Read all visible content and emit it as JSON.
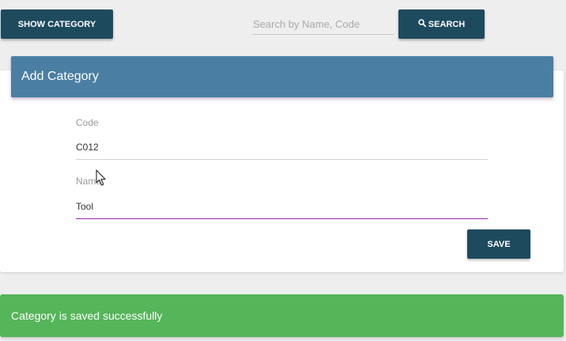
{
  "toolbar": {
    "show_category_label": "SHOW CATEGORY",
    "search_placeholder": "Search by Name, Code",
    "search_value": "",
    "search_button_label": "SEARCH",
    "search_icon": "search-icon"
  },
  "form": {
    "title": "Add Category",
    "code_label": "Code",
    "code_value": "C012",
    "name_label": "Name",
    "name_value": "Tool",
    "save_label": "SAVE"
  },
  "notification": {
    "message": "Category is saved successfully"
  },
  "colors": {
    "primary_button": "#1e4a5e",
    "header": "#4a7fa3",
    "success": "#55b559",
    "focus_underline": "#9c27b0"
  }
}
